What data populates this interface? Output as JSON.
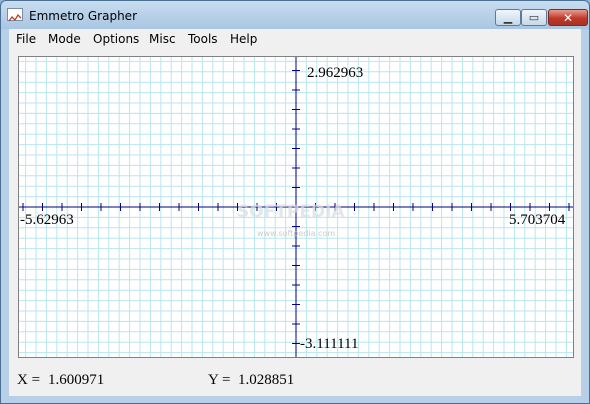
{
  "window": {
    "title": "Emmetro Grapher"
  },
  "menu": [
    "File",
    "Mode",
    "Options",
    "Misc",
    "Tools",
    "Help"
  ],
  "graph": {
    "y_max_label": "2.962963",
    "y_min_label": "-3.111111",
    "x_min_label": "-5.62963",
    "x_max_label": "5.703704",
    "watermark": "SOFTPEDIA",
    "watermark_url": "www.softpedia.com"
  },
  "status": {
    "x_label": "X =",
    "x_value": "1.600971",
    "y_label": "Y =",
    "y_value": "1.028851"
  },
  "colors": {
    "grid": "#b9e6ef",
    "axis": "#000080",
    "background": "#ffffff"
  }
}
